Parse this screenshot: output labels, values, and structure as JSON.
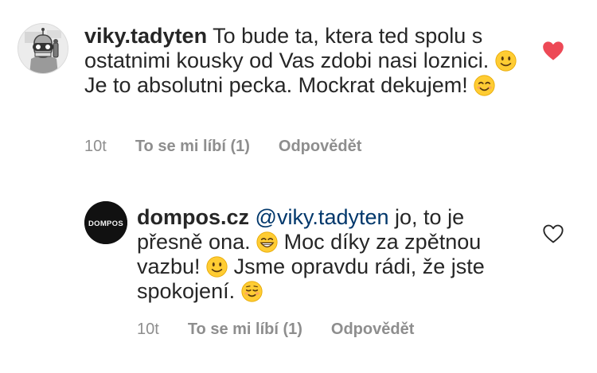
{
  "comments": [
    {
      "username": "viky.tadyten",
      "text_parts": [
        "To bude ta, ktera ted spolu s ostatnimi kousky od Vas zdobi nasi loznici.",
        "Je to absolutni pecka. Mockrat dekujem!"
      ],
      "time": "10t",
      "likes_label": "To se mi líbí (1)",
      "reply_label": "Odpovědět",
      "liked": true,
      "heart_color": "#ed4956",
      "avatar": "robot-avatar"
    },
    {
      "username": "dompos.cz",
      "avatar_label": "DOMPOS",
      "mention": "@viky.tadyten",
      "text_parts": [
        "jo, to je přesně ona.",
        "Moc díky za zpětnou vazbu!",
        "Jsme opravdu rádi, že jste spokojení."
      ],
      "time": "10t",
      "likes_label": "To se mi líbí (1)",
      "reply_label": "Odpovědět",
      "liked": false,
      "heart_color": "#262626",
      "avatar": "dompos-logo-avatar"
    }
  ],
  "colors": {
    "text": "#262626",
    "meta": "#8e8e8e",
    "mention": "#00376b",
    "like": "#ed4956"
  }
}
